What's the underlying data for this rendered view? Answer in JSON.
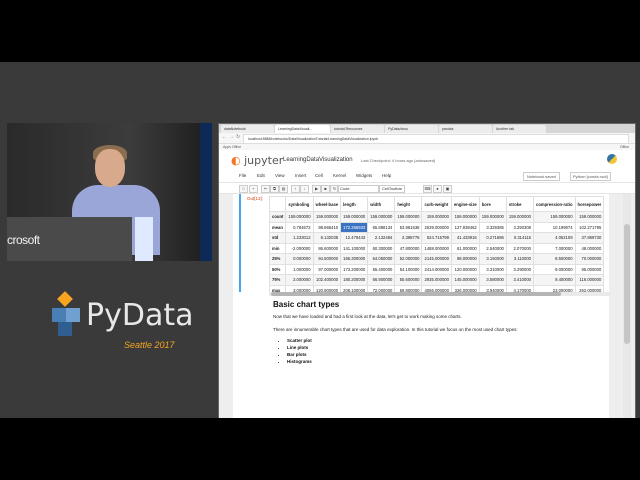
{
  "slide": {
    "pydata_word": "PyData",
    "pydata_event": "Seattle 2017",
    "podium_sign": "crosoft",
    "colors": {
      "pydata_orange": "#f7a521",
      "stage_bg": "#3a3a3a",
      "jupyter_orange": "#f37626"
    }
  },
  "browser": {
    "tabs": [
      {
        "label": "dataNotebook"
      },
      {
        "label": "LearningDataVisuali..."
      },
      {
        "label": "tutorial-Resources"
      },
      {
        "label": "PyData/docs"
      },
      {
        "label": "pandas"
      },
      {
        "label": "Another tab"
      }
    ],
    "url": "localhost:8888/notebooks/DataVisualizationTutorial/LearningDataVisualization.ipynb",
    "bookmarks": "Apps   Office",
    "profile": "Office"
  },
  "jupyter": {
    "logo": "jupyter",
    "notebook_title": "LearningDataVisualization",
    "checkpoint": "Last Checkpoint: 4 hours ago (autosaved)",
    "notebook_saved": "Notebook saved",
    "kernel": "Python [conda root]",
    "menu": [
      "File",
      "Edit",
      "View",
      "Insert",
      "Cell",
      "Kernel",
      "Widgets",
      "Help"
    ],
    "toolbar_icons": [
      "save-icon",
      "plus-icon",
      "cut-icon",
      "copy-icon",
      "paste-icon",
      "up-icon",
      "down-icon",
      "run-icon",
      "stop-icon",
      "restart-icon"
    ],
    "cell_type": "Code",
    "cell_toolbar_label": "CellToolbar"
  },
  "output": {
    "prompt": "Out[13]:",
    "columns": [
      "",
      "symboling",
      "wheel-base",
      "length",
      "width",
      "height",
      "curb-weight",
      "engine-size",
      "bore",
      "stroke",
      "compression-ratio",
      "horsepower"
    ],
    "rows": [
      {
        "label": "count",
        "values": [
          "159.000000",
          "159.000000",
          "159.000000",
          "159.000000",
          "159.000000",
          "159.000000",
          "159.000000",
          "159.000000",
          "159.000000",
          "159.000000",
          "159.000000"
        ]
      },
      {
        "label": "mean",
        "values": [
          "0.784672",
          "98.666410",
          "172.256933",
          "65.888134",
          "53.861538",
          "2539.000000",
          "127.938462",
          "3.329385",
          "3.250308",
          "10.199974",
          "102.271795"
        ]
      },
      {
        "label": "std",
        "values": [
          "1.233012",
          "6.132038",
          "12.479443",
          "2.132484",
          "2.398778",
          "524.715799",
          "41.433916",
          "0.271686",
          "0.314115",
          "4.062109",
          "37.869730"
        ]
      },
      {
        "label": "min",
        "values": [
          "-2.000000",
          "86.600000",
          "141.100000",
          "60.300000",
          "47.800000",
          "1488.000000",
          "61.000000",
          "2.540000",
          "2.070000",
          "7.000000",
          "48.000000"
        ]
      },
      {
        "label": "25%",
        "values": [
          "0.000000",
          "94.500000",
          "166.300000",
          "64.050000",
          "52.000000",
          "2145.000000",
          "98.000000",
          "3.150000",
          "3.110000",
          "8.500000",
          "70.000000"
        ]
      },
      {
        "label": "50%",
        "values": [
          "1.000000",
          "97.000000",
          "173.200000",
          "65.400000",
          "54.100000",
          "2414.000000",
          "120.000000",
          "3.310000",
          "3.290000",
          "9.000000",
          "95.000000"
        ]
      },
      {
        "label": "75%",
        "values": [
          "2.000000",
          "102.400000",
          "180.200000",
          "66.900000",
          "55.600000",
          "2935.000000",
          "145.000000",
          "3.580000",
          "3.410000",
          "9.400000",
          "116.000000"
        ]
      },
      {
        "label": "max",
        "values": [
          "3.000000",
          "120.900000",
          "208.100000",
          "72.000000",
          "59.800000",
          "4066.000000",
          "326.000000",
          "3.940000",
          "4.170000",
          "23.000000",
          "262.000000"
        ]
      }
    ]
  },
  "markdown": {
    "heading": "Basic chart types",
    "p1": "Now that we have loaded and had a first look at the data, let's get to work making some charts.",
    "p2": "There are innumerable chart types that are used for data exploration. In this tutorial we focus on the most used chart types:",
    "list": [
      "Scatter plot",
      "Line plots",
      "Bar plots",
      "Histograms"
    ]
  }
}
